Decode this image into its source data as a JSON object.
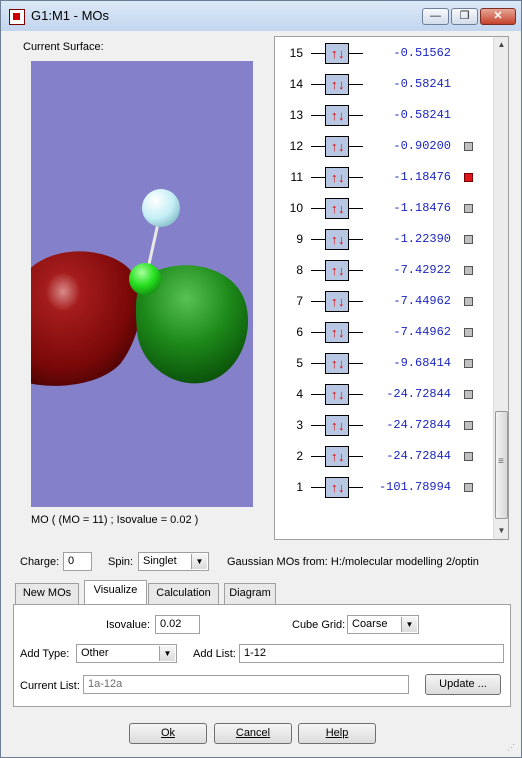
{
  "window": {
    "title": "G1:M1 - MOs"
  },
  "surface": {
    "label": "Current Surface:",
    "caption": "MO ( (MO = 11) ; Isovalue = 0.02 )"
  },
  "orbitals": [
    {
      "num": "15",
      "energy": "-0.51562",
      "sel": null
    },
    {
      "num": "14",
      "energy": "-0.58241",
      "sel": null
    },
    {
      "num": "13",
      "energy": "-0.58241",
      "sel": null
    },
    {
      "num": "12",
      "energy": "-0.90200",
      "sel": "off"
    },
    {
      "num": "11",
      "energy": "-1.18476",
      "sel": "on"
    },
    {
      "num": "10",
      "energy": "-1.18476",
      "sel": "off"
    },
    {
      "num": "9",
      "energy": "-1.22390",
      "sel": "off"
    },
    {
      "num": "8",
      "energy": "-7.42922",
      "sel": "off"
    },
    {
      "num": "7",
      "energy": "-7.44962",
      "sel": "off"
    },
    {
      "num": "6",
      "energy": "-7.44962",
      "sel": "off"
    },
    {
      "num": "5",
      "energy": "-9.68414",
      "sel": "off"
    },
    {
      "num": "4",
      "energy": "-24.72844",
      "sel": "off"
    },
    {
      "num": "3",
      "energy": "-24.72844",
      "sel": "off"
    },
    {
      "num": "2",
      "energy": "-24.72844",
      "sel": "off"
    },
    {
      "num": "1",
      "energy": "-101.78994",
      "sel": "off"
    }
  ],
  "occupancy_glyphs": {
    "up": "↑",
    "down": "↓"
  },
  "charge": {
    "label": "Charge:",
    "value": "0"
  },
  "spin": {
    "label": "Spin:",
    "value": "Singlet"
  },
  "source": {
    "text": "Gaussian MOs from:  H:/molecular modelling 2/optin"
  },
  "tabs": [
    "New MOs",
    "Visualize",
    "Calculation",
    "Diagram"
  ],
  "active_tab": "Visualize",
  "visualize": {
    "isovalue_label": "Isovalue:",
    "isovalue": "0.02",
    "cube_grid_label": "Cube Grid:",
    "cube_grid": "Coarse",
    "add_type_label": "Add Type:",
    "add_type": "Other",
    "add_list_label": "Add List:",
    "add_list": "1-12",
    "current_list_label": "Current List:",
    "current_list": "1a-12a",
    "update_label": "Update ..."
  },
  "buttons": {
    "ok": "Ok",
    "cancel": "Cancel",
    "help": "Help"
  },
  "colors": {
    "viewport_bg": "#8480c9",
    "lobe_red": "#8f0b0b",
    "lobe_green": "#1b7d18",
    "hydrogen": "#c8f2f7",
    "selected": "#e0161f",
    "energy_text": "#1c26c0"
  },
  "icons": {
    "scroll_up": "▲",
    "scroll_down": "▼",
    "dropdown": "▼",
    "minimize": "—",
    "maximize": "❐",
    "close": "✕"
  }
}
